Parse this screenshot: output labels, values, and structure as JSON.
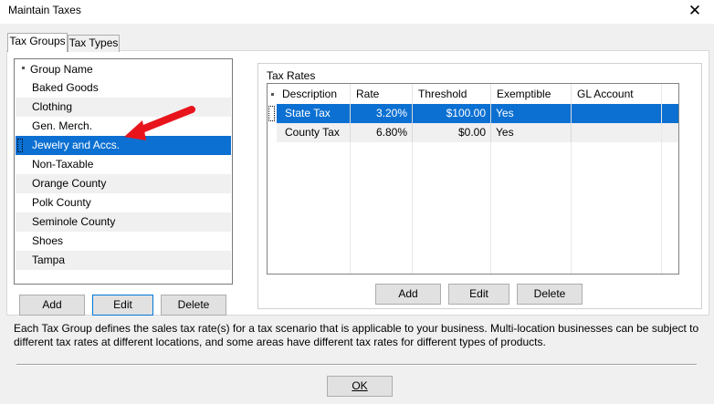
{
  "window": {
    "title": "Maintain Taxes",
    "close_glyph": "✕"
  },
  "tabs": [
    {
      "label": "Tax Groups",
      "active": true
    },
    {
      "label": "Tax Types",
      "active": false
    }
  ],
  "groups": {
    "header": "Group Name",
    "items": [
      {
        "label": "Baked Goods"
      },
      {
        "label": "Clothing"
      },
      {
        "label": "Gen. Merch."
      },
      {
        "label": "Jewelry and Accs.",
        "selected": true
      },
      {
        "label": "Non-Taxable"
      },
      {
        "label": "Orange County"
      },
      {
        "label": "Polk County"
      },
      {
        "label": "Seminole County"
      },
      {
        "label": "Shoes"
      },
      {
        "label": "Tampa"
      }
    ],
    "buttons": {
      "add": "Add",
      "edit": "Edit",
      "delete": "Delete"
    }
  },
  "tax_rates": {
    "label": "Tax Rates",
    "columns": [
      "Description",
      "Rate",
      "Threshold",
      "Exemptible",
      "GL Account"
    ],
    "rows": [
      {
        "description": "State Tax",
        "rate": "3.20%",
        "threshold": "$100.00",
        "exemptible": "Yes",
        "gl_account": "",
        "selected": true
      },
      {
        "description": "County Tax",
        "rate": "6.80%",
        "threshold": "$0.00",
        "exemptible": "Yes",
        "gl_account": "",
        "selected": false
      }
    ],
    "buttons": {
      "add": "Add",
      "edit": "Edit",
      "delete": "Delete"
    }
  },
  "description_text": "Each Tax Group defines the sales tax rate(s) for a tax scenario that is applicable to your business. Multi-location businesses can be subject to different tax rates at different locations, and some areas have different tax rates for different types of products.",
  "ok_button": "OK",
  "colors": {
    "selection": "#0c70d2",
    "annotation_arrow": "#e8141c",
    "focus_border": "#0078d7"
  }
}
